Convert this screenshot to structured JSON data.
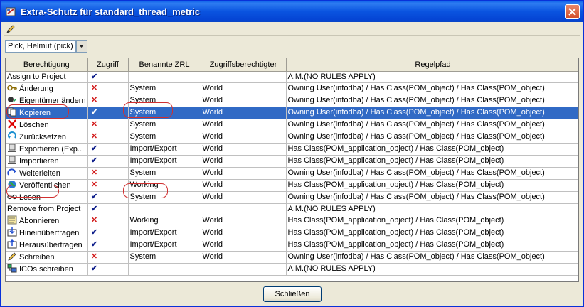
{
  "window": {
    "title": "Extra-Schutz für standard_thread_metric"
  },
  "user_select": {
    "value": "Pick, Helmut (pick)"
  },
  "columns": [
    "Berechtigung",
    "Zugriff",
    "Benannte ZRL",
    "Zugriffsberechtigter",
    "Regelpfad"
  ],
  "rows": [
    {
      "name": "Assign to Project",
      "icon": "",
      "access": "yes",
      "zrl": "",
      "accessor": "",
      "rule": "A.M.(NO RULES APPLY)"
    },
    {
      "name": "Änderung",
      "icon": "key-icon",
      "access": "no",
      "zrl": "System",
      "accessor": "World",
      "rule": "Owning User(infodba) / Has Class(POM_object) / Has Class(POM_object)"
    },
    {
      "name": "Eigentümer ändern",
      "icon": "owner-change-icon",
      "access": "no",
      "zrl": "System",
      "accessor": "World",
      "rule": "Owning User(infodba) / Has Class(POM_object) / Has Class(POM_object)"
    },
    {
      "name": "Kopieren",
      "icon": "copy-icon",
      "access": "yes",
      "zrl": "System",
      "accessor": "World",
      "rule": "Owning User(infodba) / Has Class(POM_object) / Has Class(POM_object)",
      "selected": true
    },
    {
      "name": "Löschen",
      "icon": "delete-icon",
      "access": "no",
      "zrl": "System",
      "accessor": "World",
      "rule": "Owning User(infodba) / Has Class(POM_object) / Has Class(POM_object)"
    },
    {
      "name": "Zurücksetzen",
      "icon": "reset-icon",
      "access": "no",
      "zrl": "System",
      "accessor": "World",
      "rule": "Owning User(infodba) / Has Class(POM_object) / Has Class(POM_object)"
    },
    {
      "name": "Exportieren (Exp...",
      "icon": "export-icon",
      "access": "yes",
      "zrl": "Import/Export",
      "accessor": "World",
      "rule": "Has Class(POM_application_object) / Has Class(POM_object)"
    },
    {
      "name": "Importieren",
      "icon": "import-icon",
      "access": "yes",
      "zrl": "Import/Export",
      "accessor": "World",
      "rule": "Has Class(POM_application_object) / Has Class(POM_object)"
    },
    {
      "name": "Weiterleiten",
      "icon": "forward-icon",
      "access": "no",
      "zrl": "System",
      "accessor": "World",
      "rule": "Owning User(infodba) / Has Class(POM_object) / Has Class(POM_object)"
    },
    {
      "name": "Veröffentlichen",
      "icon": "globe-icon",
      "access": "no",
      "zrl": "Working",
      "accessor": "World",
      "rule": "Has Class(POM_application_object) / Has Class(POM_object)"
    },
    {
      "name": "Lesen",
      "icon": "glasses-icon",
      "access": "yes",
      "zrl": "System",
      "accessor": "World",
      "rule": "Owning User(infodba) / Has Class(POM_object) / Has Class(POM_object)"
    },
    {
      "name": "Remove from Project",
      "icon": "",
      "access": "yes",
      "zrl": "",
      "accessor": "",
      "rule": "A.M.(NO RULES APPLY)"
    },
    {
      "name": "Abonnieren",
      "icon": "subscribe-icon",
      "access": "no",
      "zrl": "Working",
      "accessor": "World",
      "rule": "Has Class(POM_application_object) / Has Class(POM_object)"
    },
    {
      "name": "Hineinübertragen",
      "icon": "transfer-in-icon",
      "access": "yes",
      "zrl": "Import/Export",
      "accessor": "World",
      "rule": "Has Class(POM_application_object) / Has Class(POM_object)"
    },
    {
      "name": "Herausübertragen",
      "icon": "transfer-out-icon",
      "access": "yes",
      "zrl": "Import/Export",
      "accessor": "World",
      "rule": "Has Class(POM_application_object) / Has Class(POM_object)"
    },
    {
      "name": "Schreiben",
      "icon": "pencil-icon",
      "access": "no",
      "zrl": "System",
      "accessor": "World",
      "rule": "Owning User(infodba) / Has Class(POM_object) / Has Class(POM_object)"
    },
    {
      "name": "ICOs schreiben",
      "icon": "ico-write-icon",
      "access": "yes",
      "zrl": "",
      "accessor": "",
      "rule": "A.M.(NO RULES APPLY)"
    }
  ],
  "marks": {
    "yes": "✔",
    "no": "✕"
  },
  "footer": {
    "close_label": "Schließen"
  }
}
